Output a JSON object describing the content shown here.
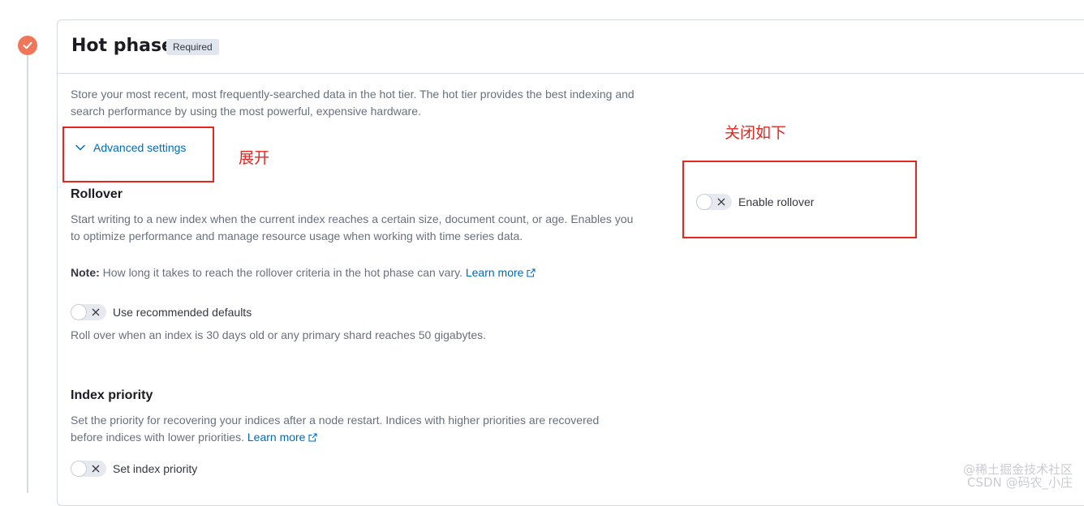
{
  "phase": {
    "title": "Hot phase",
    "badge": "Required",
    "description_line1": "Store your most recent, most frequently-searched data in the hot tier. The hot tier provides the best indexing and",
    "description_line2": "search performance by using the most powerful, expensive hardware.",
    "advanced_settings": "Advanced settings"
  },
  "rollover": {
    "heading": "Rollover",
    "desc_line1": "Start writing to a new index when the current index reaches a certain size, document count, or age. Enables you",
    "desc_line2": "to optimize performance and manage resource usage when working with time series data.",
    "note_label": "Note:",
    "note_text": "How long it takes to reach the rollover criteria in the hot phase can vary.",
    "learn_more": "Learn more",
    "use_defaults_label": "Use recommended defaults",
    "use_defaults_checked": false,
    "defaults_help": "Roll over when an index is 30 days old or any primary shard reaches 50 gigabytes.",
    "enable_rollover_label": "Enable rollover",
    "enable_rollover_checked": false
  },
  "index_priority": {
    "heading": "Index priority",
    "desc_line1": "Set the priority for recovering your indices after a node restart. Indices with higher priorities are recovered",
    "desc_line2": "before indices with lower priorities.",
    "learn_more": "Learn more",
    "set_priority_label": "Set index priority",
    "set_priority_checked": false
  },
  "annotations": {
    "expand_label": "展开",
    "close_label": "关闭如下",
    "color": "#e5261f"
  },
  "watermark": {
    "line1": "@稀土掘金技术社区",
    "line2": "CSDN @码农_小庄"
  },
  "colors": {
    "accent_link": "#006bb8",
    "step_complete": "#f0765a"
  },
  "icons": {
    "step": "check-icon",
    "expand": "chevron-down-icon",
    "external": "external-link-icon",
    "switch_off": "cross-icon"
  }
}
